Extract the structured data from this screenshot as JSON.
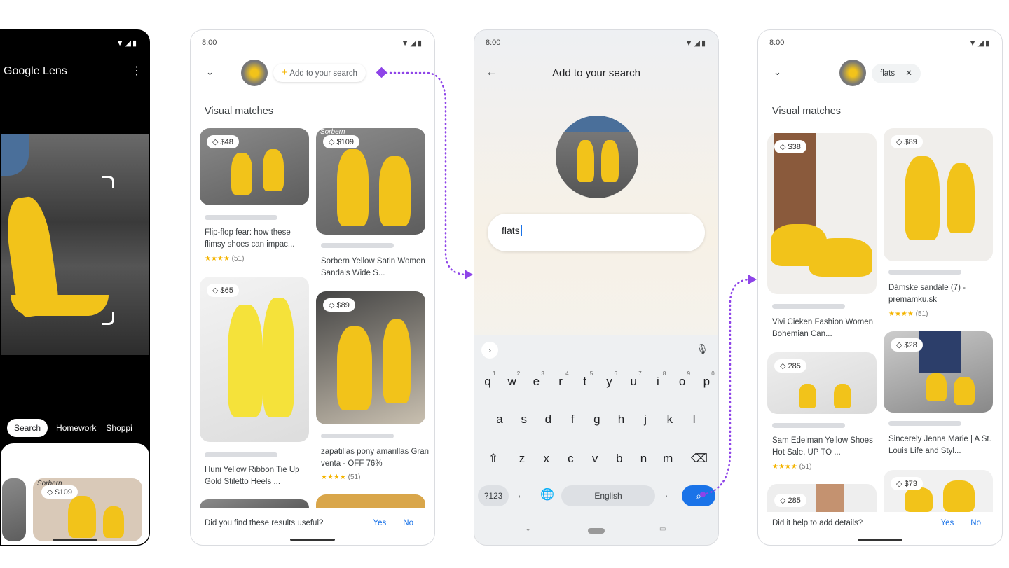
{
  "accent": "#8e44e8",
  "screen1": {
    "app_title": "Google Lens",
    "tabs": [
      "Search",
      "Homework",
      "Shoppi"
    ],
    "price": "$109",
    "source_label": "Sorbern"
  },
  "screen2": {
    "time": "8:00",
    "add_chip": "Add to your search",
    "section": "Visual matches",
    "results": [
      {
        "price": "$48",
        "title": "Flip-flop fear: how these flimsy shoes can impac...",
        "rating": "★★★★",
        "count": "(51)"
      },
      {
        "price": "$109",
        "title": "Sorbern Yellow Satin Women Sandals Wide S...",
        "source_label": "Sorbern"
      },
      {
        "price": "$65",
        "title": "Huni Yellow Ribbon Tie Up Gold Stiletto Heels ..."
      },
      {
        "price": "$89",
        "title": "zapatillas pony amarillas Gran venta - OFF 76%",
        "rating": "★★★★",
        "count": "(51)"
      }
    ],
    "feedback": "Did you find these results useful?",
    "yes": "Yes",
    "no": "No"
  },
  "screen3": {
    "time": "8:00",
    "title": "Add to your search",
    "input_value": "flats",
    "keyboard": {
      "row1": [
        "q",
        "w",
        "e",
        "r",
        "t",
        "y",
        "u",
        "i",
        "o",
        "p"
      ],
      "nums": [
        "1",
        "2",
        "3",
        "4",
        "5",
        "6",
        "7",
        "8",
        "9",
        "0"
      ],
      "row2": [
        "a",
        "s",
        "d",
        "f",
        "g",
        "h",
        "j",
        "k",
        "l"
      ],
      "row3": [
        "z",
        "x",
        "c",
        "v",
        "b",
        "n",
        "m"
      ],
      "sym": "?123",
      "space": "English",
      "comma": ",",
      "period": "."
    }
  },
  "screen4": {
    "time": "8:00",
    "chip": "flats",
    "section": "Visual matches",
    "results": [
      {
        "price": "$38",
        "title": "Vivi Cieken Fashion Women Bohemian Can..."
      },
      {
        "price": "$89",
        "title": "Dámske sandále (7) - premamku.sk",
        "rating": "★★★★",
        "count": "(51)"
      },
      {
        "price": "285",
        "title": "Sam Edelman Yellow Shoes Hot Sale, UP TO ...",
        "rating": "★★★★",
        "count": "(51)"
      },
      {
        "price": "$28",
        "title": "Sincerely Jenna Marie | A St. Louis Life and Styl..."
      },
      {
        "price": "285"
      },
      {
        "price": "$73"
      }
    ],
    "feedback": "Did it help to add details?",
    "yes": "Yes",
    "no": "No"
  }
}
